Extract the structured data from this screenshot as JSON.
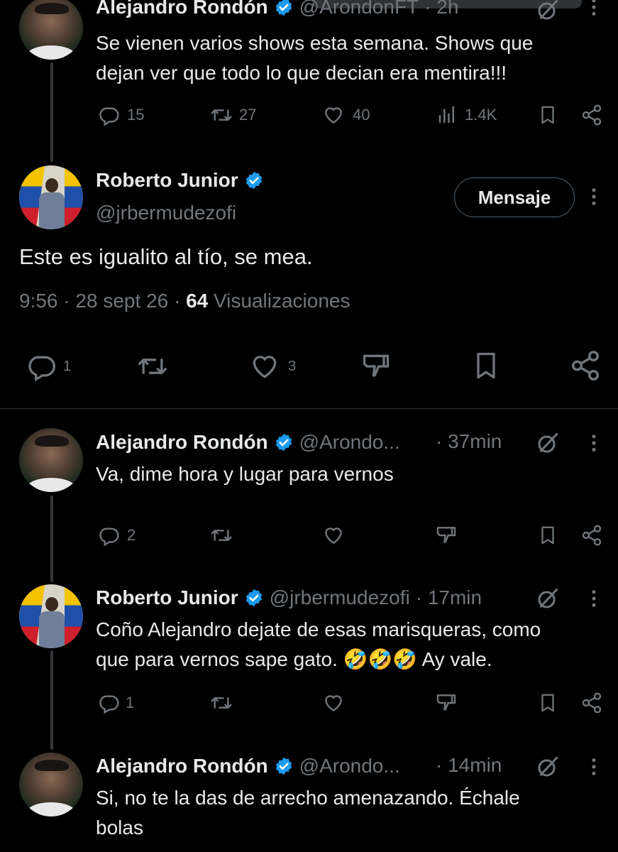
{
  "tweets": [
    {
      "name": "Alejandro Rondón",
      "handle": "@ArondonFT",
      "time": "· 2h",
      "text1": "Se vienen varios shows esta semana. Shows que",
      "text2": "dejan ver que todo lo que decian era mentira!!!",
      "replies": "15",
      "retweets": "27",
      "likes": "40",
      "views": "1.4K"
    },
    {
      "name": "Roberto Junior",
      "handle": "@jrbermudezofi",
      "message_button": "Mensaje",
      "text": "Este es igualito al tío, se mea.",
      "time": "9:56",
      "date": "28 sept 26",
      "view_count": "64",
      "view_label": "Visualizaciones",
      "replies": "1",
      "likes": "3"
    },
    {
      "name": "Alejandro Rondón",
      "handle": "@Arondo...",
      "time": "· 37min",
      "text": "Va, dime hora y lugar para vernos",
      "replies": "2"
    },
    {
      "name": "Roberto Junior",
      "handle": "@jrbermudezofi",
      "time": "· 17min",
      "text1": "Coño Alejandro dejate de esas marisqueras, como",
      "text2a": "que para vernos sape gato. ",
      "emojis": "🤣🤣🤣",
      "text2b": " Ay vale.",
      "replies": "1"
    },
    {
      "name": "Alejandro Rondón",
      "handle": "@Arondo...",
      "time": "· 14min",
      "text1": "Si, no te la das de arrecho amenazando. Échale",
      "text2": "bolas"
    }
  ],
  "colors": {
    "background": "#000000",
    "text": "#e7e9ea",
    "muted": "#71767b",
    "verified": "#1d9bf0"
  },
  "icons": [
    "reply-icon",
    "retweet-icon",
    "like-icon",
    "views-icon",
    "bookmark-icon",
    "share-icon",
    "dislike-icon",
    "grok-icon",
    "more-icon",
    "verified-icon"
  ]
}
